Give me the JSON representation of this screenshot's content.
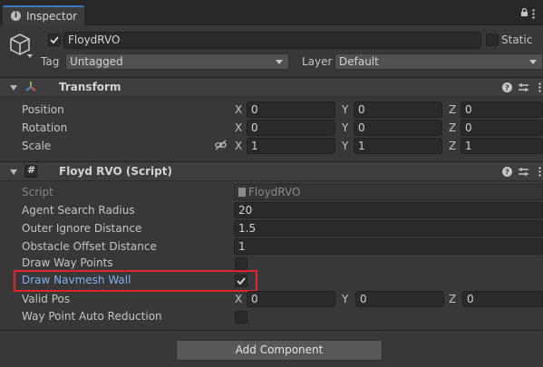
{
  "window": {
    "tab_title": "Inspector"
  },
  "gameobject": {
    "name": "FloydRVO",
    "static_label": "Static",
    "tag_label": "Tag",
    "tag_value": "Untagged",
    "layer_label": "Layer",
    "layer_value": "Default"
  },
  "transform": {
    "title": "Transform",
    "rows": [
      {
        "label": "Position",
        "x": "0",
        "y": "0",
        "z": "0"
      },
      {
        "label": "Rotation",
        "x": "0",
        "y": "0",
        "z": "0"
      },
      {
        "label": "Scale",
        "x": "1",
        "y": "1",
        "z": "1"
      }
    ]
  },
  "axes": {
    "x": "X",
    "y": "Y",
    "z": "Z"
  },
  "script_component": {
    "title": "Floyd RVO (Script)",
    "script_label": "Script",
    "script_value": "FloydRVO",
    "fields": [
      {
        "label": "Agent Search Radius",
        "value": "20"
      },
      {
        "label": "Outer Ignore Distance",
        "value": "1.5"
      },
      {
        "label": "Obstacle Offset Distance",
        "value": "1"
      }
    ],
    "draw_way_points_label": "Draw Way Points",
    "draw_navmesh_wall_label": "Draw Navmesh Wall",
    "valid_pos": {
      "label": "Valid Pos",
      "x": "0",
      "y": "0",
      "z": "0"
    },
    "way_point_auto_reduction_label": "Way Point Auto Reduction"
  },
  "add_component_label": "Add Component",
  "colors": {
    "background": "#383838",
    "highlight_border": "#e0262b",
    "selected_label": "#7fb0f0"
  }
}
